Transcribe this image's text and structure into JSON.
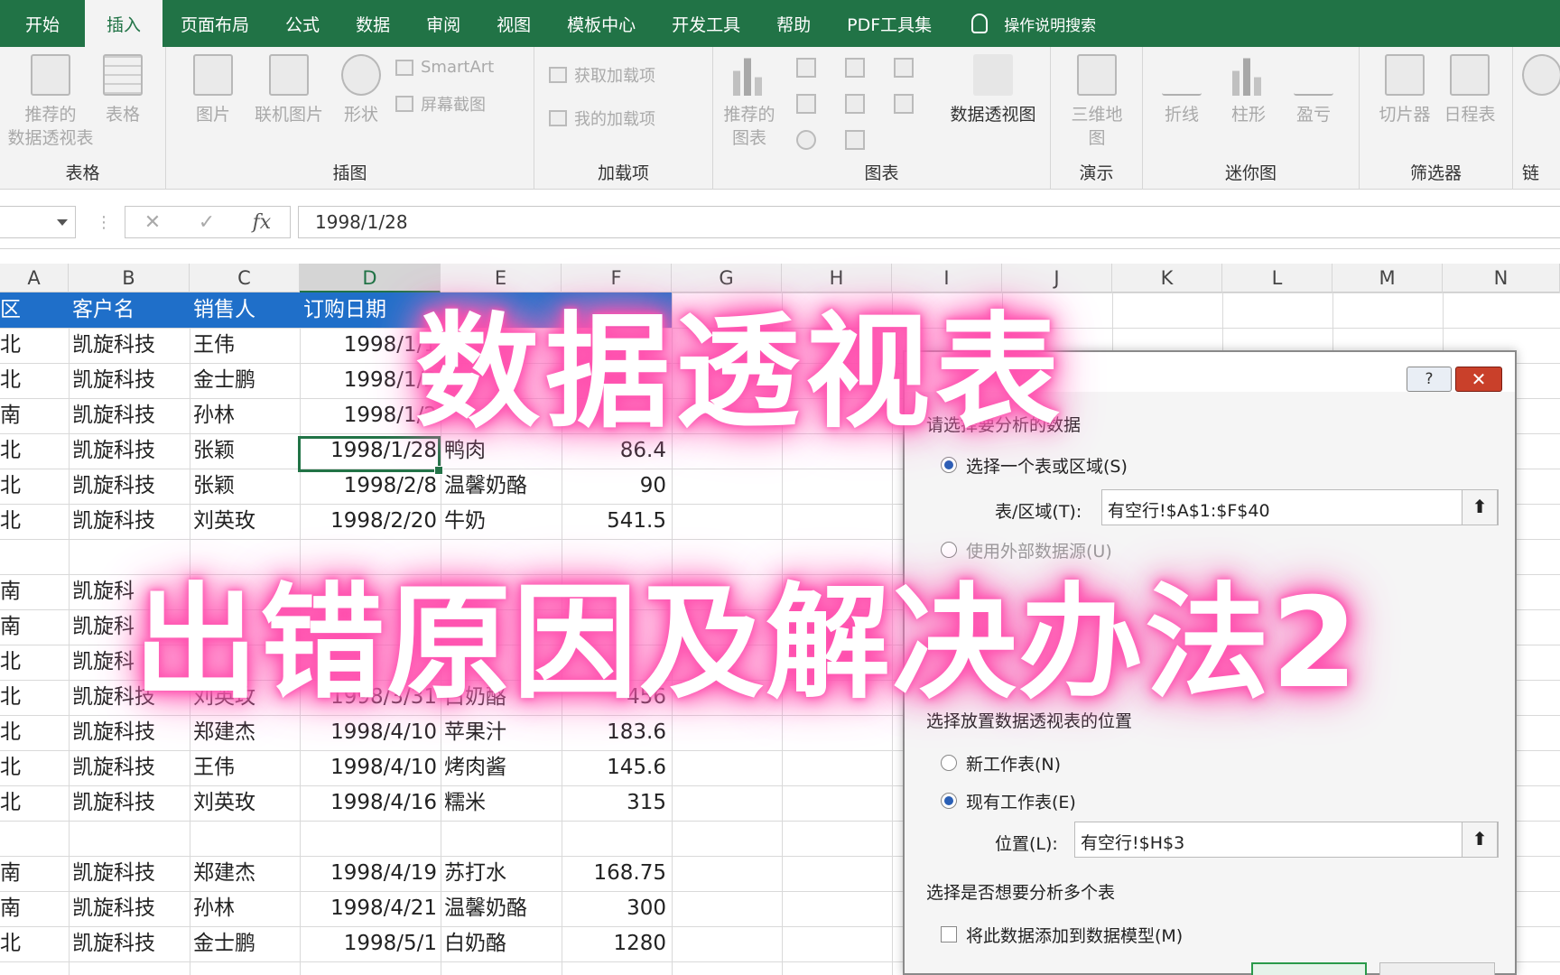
{
  "tabs": [
    "开始",
    "插入",
    "页面布局",
    "公式",
    "数据",
    "审阅",
    "视图",
    "模板中心",
    "开发工具",
    "帮助",
    "PDF工具集"
  ],
  "active_tab": "插入",
  "tell_me": "操作说明搜索",
  "ribbon": {
    "groups": {
      "tables": "表格",
      "illustrations": "插图",
      "addins": "加载项",
      "charts": "图表",
      "tours": "演示",
      "sparklines": "迷你图",
      "filters": "筛选器",
      "links": "链"
    },
    "buttons": {
      "recommended_pivot_1": "推荐的",
      "recommended_pivot_2": "数据透视表",
      "table": "表格",
      "pictures": "图片",
      "online_pictures": "联机图片",
      "shapes": "形状",
      "smartart": "SmartArt",
      "screenshot": "屏幕截图",
      "get_addins": "获取加载项",
      "my_addins": "我的加载项",
      "recommended_charts_1": "推荐的",
      "recommended_charts_2": "图表",
      "pivot_chart": "数据透视图",
      "map3d_1": "三维地",
      "map3d_2": "图",
      "line": "折线",
      "column": "柱形",
      "winloss": "盈亏",
      "slicer": "切片器",
      "timeline": "日程表"
    }
  },
  "formula_bar": {
    "fx": "fx",
    "cancel": "✕",
    "enter": "✓",
    "value": "1998/1/28"
  },
  "columns": [
    "A",
    "B",
    "C",
    "D",
    "E",
    "F",
    "G",
    "H",
    "I",
    "J",
    "K",
    "L",
    "M",
    "N"
  ],
  "header_row": [
    "区",
    "客户名",
    "销售人",
    "订购日期",
    "",
    ""
  ],
  "rows": [
    [
      "北",
      "凯旋科技",
      "王伟",
      "1998/1/1",
      "",
      ""
    ],
    [
      "北",
      "凯旋科技",
      "金士鹏",
      "1998/1/2",
      "",
      ""
    ],
    [
      "南",
      "凯旋科技",
      "孙林",
      "1998/1/2",
      "",
      ""
    ],
    [
      "北",
      "凯旋科技",
      "张颖",
      "1998/1/28",
      "鸭肉",
      "86.4"
    ],
    [
      "北",
      "凯旋科技",
      "张颖",
      "1998/2/8",
      "温馨奶酪",
      "90"
    ],
    [
      "北",
      "凯旋科技",
      "刘英玫",
      "1998/2/20",
      "牛奶",
      "541.5"
    ],
    [
      "",
      "",
      "",
      "",
      "",
      ""
    ],
    [
      "南",
      "凯旋科",
      "",
      "",
      "",
      ""
    ],
    [
      "南",
      "凯旋科",
      "",
      "",
      "",
      ""
    ],
    [
      "北",
      "凯旋科",
      "",
      "",
      "",
      ""
    ],
    [
      "北",
      "凯旋科技",
      "刘英玫",
      "1998/3/31",
      "白奶酪",
      "456"
    ],
    [
      "北",
      "凯旋科技",
      "郑建杰",
      "1998/4/10",
      "苹果汁",
      "183.6"
    ],
    [
      "北",
      "凯旋科技",
      "王伟",
      "1998/4/10",
      "烤肉酱",
      "145.6"
    ],
    [
      "北",
      "凯旋科技",
      "刘英玫",
      "1998/4/16",
      "糯米",
      "315"
    ],
    [
      "",
      "",
      "",
      "",
      "",
      ""
    ],
    [
      "南",
      "凯旋科技",
      "郑建杰",
      "1998/4/19",
      "苏打水",
      "168.75"
    ],
    [
      "南",
      "凯旋科技",
      "孙林",
      "1998/4/21",
      "温馨奶酪",
      "300"
    ],
    [
      "北",
      "凯旋科技",
      "金士鹏",
      "1998/5/1",
      "白奶酪",
      "1280"
    ],
    [
      "",
      "",
      "",
      "",
      "",
      ""
    ]
  ],
  "dialog": {
    "help": "?",
    "close": "✕",
    "section1": "请选择要分析的数据",
    "opt_table": "选择一个表或区域(S)",
    "range_label": "表/区域(T):",
    "range_value": "有空行!$A$1:$F$40",
    "opt_external": "使用外部数据源(U)",
    "section2": "选择放置数据透视表的位置",
    "opt_new": "新工作表(N)",
    "opt_existing": "现有工作表(E)",
    "location_label": "位置(L):",
    "location_value": "有空行!$H$3",
    "section3": "选择是否想要分析多个表",
    "add_model": "将此数据添加到数据模型(M)",
    "collapse": "⬆"
  },
  "overlay": {
    "line1": "数据透视表",
    "line2": "出错原因及解决办法2"
  },
  "colors": {
    "excel_green": "#217346",
    "header_blue": "#1f6fc9",
    "glow_pink": "#ff4fae"
  }
}
